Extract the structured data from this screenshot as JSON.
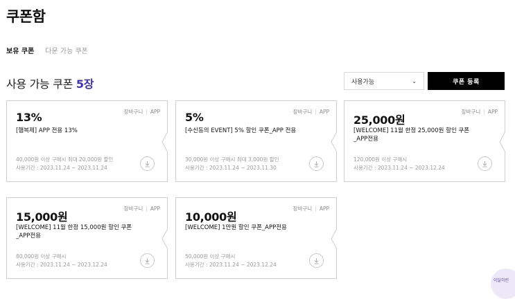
{
  "page": {
    "title": "쿠폰함"
  },
  "tabs": [
    {
      "label": "보유 쿠폰",
      "active": true
    },
    {
      "label": "다운 가능 쿠폰",
      "active": false
    }
  ],
  "section": {
    "title": "사용 가능 쿠폰",
    "count": "5장"
  },
  "filter": {
    "selected": "사용가능"
  },
  "register_button": {
    "label": "쿠폰 등록"
  },
  "coupon_meta": {
    "place": "장바구니",
    "channel": "APP"
  },
  "coupons": [
    {
      "amount": "13%",
      "name": "[햄복제] APP 전용 13%",
      "condition": "40,000원 이상 구매시 최대 20,000원 할인",
      "period": "사용기간 : 2023.11.24 ~ 2023.11.24"
    },
    {
      "amount": "5%",
      "name": "[수신동의 EVENT] 5% 할인 쿠폰_APP 전용",
      "condition": "30,000원 이상 구매시 최대 3,000원 할인",
      "period": "사용기간 : 2023.11.24 ~ 2023.11.30"
    },
    {
      "amount": "25,000원",
      "name": "[WELCOME] 11월 한정 25,000원 할인 쿠폰 _APP전용",
      "condition": "120,000원 이상 구매시",
      "period": "사용기간 : 2023.11.24 ~ 2023.12.24"
    },
    {
      "amount": "15,000원",
      "name": "[WELCOME] 11월 한정 15,000원 할인 쿠폰 _APP전용",
      "condition": "80,000원 이상 구매시",
      "period": "사용기간 : 2023.11.24 ~ 2023.12.24"
    },
    {
      "amount": "10,000원",
      "name": "[WELCOME] 1만원 할인 쿠폰_APP전용",
      "condition": "50,000원 이상 구매시",
      "period": "사용기간 : 2023.11.24 ~ 2023.12.24"
    }
  ],
  "chat": {
    "label": "이달하린"
  },
  "icons": {
    "download": "download-icon",
    "dropdown": "chevron-down-icon"
  }
}
